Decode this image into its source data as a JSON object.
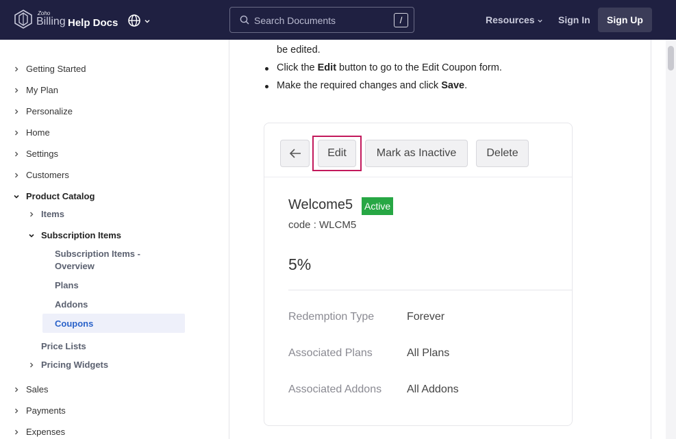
{
  "header": {
    "brand_small": "Zoho",
    "brand_main": "Billing",
    "brand_help": "Help Docs",
    "search_placeholder": "Search Documents",
    "search_shortcut": "/",
    "nav_resources": "Resources",
    "nav_signin": "Sign In",
    "nav_signup": "Sign Up"
  },
  "sidebar": {
    "items": [
      {
        "label": "Getting Started"
      },
      {
        "label": "My Plan"
      },
      {
        "label": "Personalize"
      },
      {
        "label": "Home"
      },
      {
        "label": "Settings"
      },
      {
        "label": "Customers"
      },
      {
        "label": "Product Catalog"
      },
      {
        "label": "Sales"
      },
      {
        "label": "Payments"
      },
      {
        "label": "Expenses"
      }
    ],
    "catalog_children": {
      "items": "Items",
      "subscription_items": "Subscription Items",
      "overview_line1": "Subscription Items -",
      "overview_line2": "Overview",
      "plans": "Plans",
      "addons": "Addons",
      "coupons": "Coupons",
      "price_lists": "Price Lists",
      "pricing_widgets": "Pricing Widgets"
    }
  },
  "content": {
    "line_top": "be edited.",
    "bullet1_pre": "Click the ",
    "bullet1_bold": "Edit",
    "bullet1_post": " button to go to the Edit Coupon form.",
    "bullet2_pre": "Make the required changes and click ",
    "bullet2_bold": "Save",
    "bullet2_post": "."
  },
  "coupon_card": {
    "back_icon": "arrow-left-icon",
    "edit_label": "Edit",
    "inactive_label": "Mark as Inactive",
    "delete_label": "Delete",
    "name": "Welcome5",
    "status": "Active",
    "code": "code : WLCM5",
    "discount": "5%",
    "details": [
      {
        "label": "Redemption Type",
        "value": "Forever"
      },
      {
        "label": "Associated Plans",
        "value": "All Plans"
      },
      {
        "label": "Associated Addons",
        "value": "All Addons"
      }
    ]
  },
  "colors": {
    "header_bg": "#1f2041",
    "active_badge": "#27a744",
    "highlight_border": "#c2185b",
    "active_link": "#2a62c9"
  }
}
